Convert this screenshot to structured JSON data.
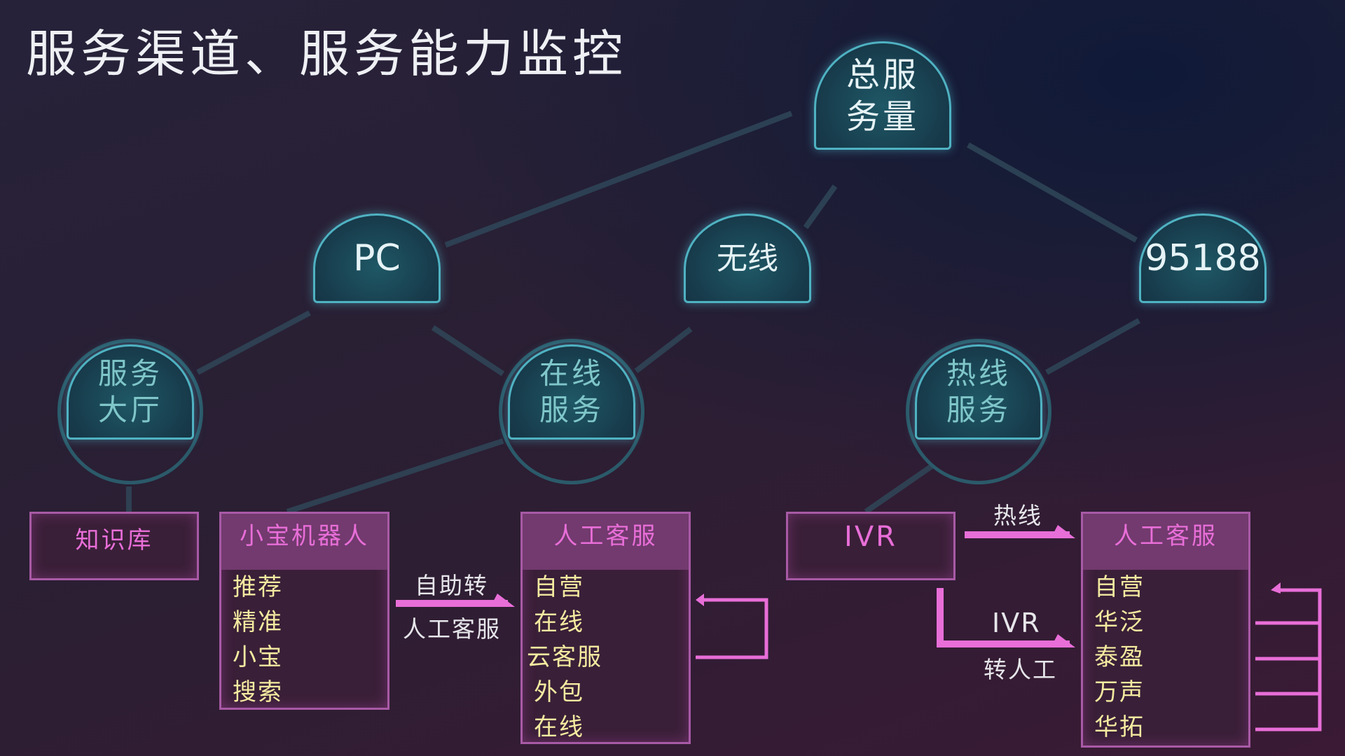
{
  "title": "服务渠道、服务能力监控",
  "root": {
    "label": "总服务量"
  },
  "channels": [
    {
      "label": "PC"
    },
    {
      "label": "无线"
    },
    {
      "label": "95188"
    }
  ],
  "services": [
    {
      "label": "服务大厅"
    },
    {
      "label": "在线服务"
    },
    {
      "label": "热线服务"
    }
  ],
  "boxes": {
    "knowledge": {
      "title": "知识库"
    },
    "robot": {
      "title": "小宝机器人",
      "items": [
        "推荐",
        "精准",
        "小宝",
        "搜索"
      ]
    },
    "human1": {
      "title": "人工客服",
      "items": [
        "自营",
        "在线",
        "云客服",
        "外包",
        "在线"
      ]
    },
    "ivr": {
      "title": "IVR"
    },
    "human2": {
      "title": "人工客服",
      "items": [
        "自营",
        "华泛",
        "泰盈",
        "万声",
        "华拓"
      ]
    }
  },
  "arrows": {
    "self_top": "自助转",
    "self_bottom": "人工客服",
    "hotline": "热线",
    "ivr_top": "IVR",
    "ivr_bottom": "转人工"
  },
  "colors": {
    "accent": "#e86ed8",
    "node": "#4fb2c2",
    "item": "#f4eaa0"
  }
}
